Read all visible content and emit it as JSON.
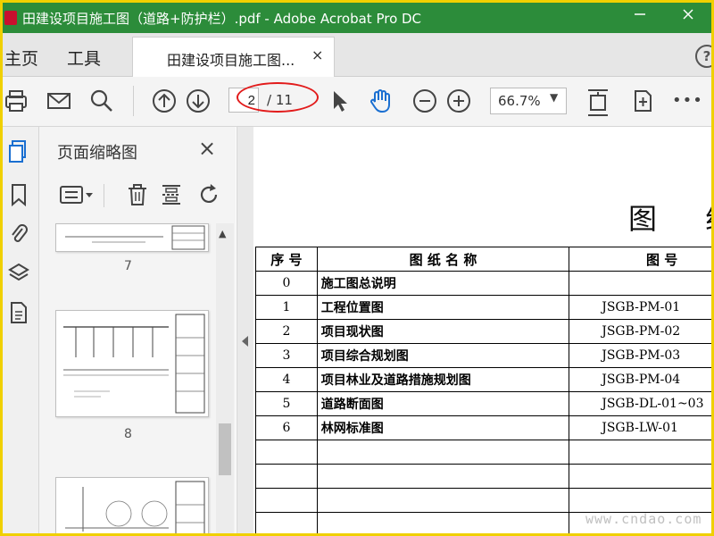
{
  "window": {
    "title": "田建设项目施工图（道路+防护栏）.pdf - Adobe Acrobat Pro DC",
    "minimize_icon": "minimize-icon",
    "maximize_icon": "maximize-icon",
    "close_icon": "close-icon"
  },
  "menu": {
    "home": "主页",
    "tools": "工具"
  },
  "tab": {
    "label": "田建设项目施工图...",
    "close": "×"
  },
  "help": "?",
  "toolbar": {
    "page_current": "2",
    "page_total": "/ 11",
    "zoom": "66.7%",
    "more": "•••"
  },
  "thumbnail_pane": {
    "title": "页面缩略图",
    "close": "×",
    "pages": [
      {
        "number": "7"
      },
      {
        "number": "8"
      },
      {
        "number": ""
      }
    ]
  },
  "document": {
    "heading": "图 纸",
    "table": {
      "headers": [
        "序 号",
        "图 纸 名 称",
        "图 号"
      ],
      "rows": [
        {
          "no": "0",
          "name": "施工图总说明",
          "code": ""
        },
        {
          "no": "1",
          "name": "工程位置图",
          "code": "JSGB-PM-01"
        },
        {
          "no": "2",
          "name": "项目现状图",
          "code": "JSGB-PM-02"
        },
        {
          "no": "3",
          "name": "项目综合规划图",
          "code": "JSGB-PM-03"
        },
        {
          "no": "4",
          "name": "项目林业及道路措施规划图",
          "code": "JSGB-PM-04"
        },
        {
          "no": "5",
          "name": "道路断面图",
          "code": "JSGB-DL-01~03"
        },
        {
          "no": "6",
          "name": "林网标准图",
          "code": "JSGB-LW-01"
        },
        {
          "no": "",
          "name": "",
          "code": ""
        },
        {
          "no": "",
          "name": "",
          "code": ""
        },
        {
          "no": "",
          "name": "",
          "code": ""
        },
        {
          "no": "",
          "name": "",
          "code": ""
        }
      ]
    },
    "watermark": "www.cndao.com"
  },
  "colors": {
    "titlebar": "#2c8c3a",
    "annotation_circle": "#e21b1b",
    "border_frame": "#f0d000",
    "accent_blue": "#1a6fd1"
  }
}
